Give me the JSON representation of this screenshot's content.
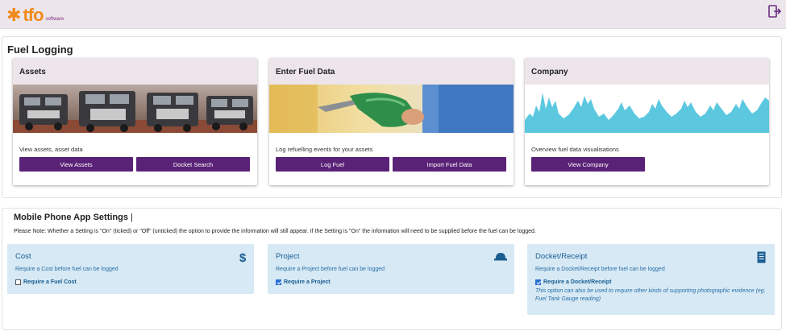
{
  "header": {
    "logo_text": "tfo",
    "logo_sub": "software",
    "logout_icon": "logout-icon"
  },
  "section_title": "Fuel Logging",
  "cards": [
    {
      "title": "Assets",
      "description": "View assets, asset data",
      "buttons": [
        "View Assets",
        "Docket Search"
      ]
    },
    {
      "title": "Enter Fuel Data",
      "description": "Log refuelling events for your assets",
      "buttons": [
        "Log Fuel",
        "Import Fuel Data"
      ]
    },
    {
      "title": "Company",
      "description": "Overview fuel data visualisations",
      "buttons": [
        "View Company"
      ]
    }
  ],
  "settings": {
    "title": "Mobile Phone App Settings",
    "caret": "|",
    "note": "Please Note: Whether a Setting is \"On\" (ticked) or \"Off\" (unticked) the option to provide the information will still appear. If the Setting is \"On\" the information will need to be supplied before the fuel can be logged.",
    "items": [
      {
        "title": "Cost",
        "description": "Require a Cost before fuel can be logged",
        "checkbox_label": "Require a Fuel Cost",
        "checked": false,
        "icon": "dollar-icon"
      },
      {
        "title": "Project",
        "description": "Require a Project before fuel can be logged",
        "checkbox_label": "Require a Project",
        "checked": true,
        "icon": "hard-hat-icon"
      },
      {
        "title": "Docket/Receipt",
        "description": "Require a Docket/Receipt before fuel can be logged",
        "checkbox_label": "Require a Docket/Receipt",
        "checked": true,
        "extra": "This option can also be used to require other kinds of supporting photographic evidence (eg. Fuel Tank Gauge reading)",
        "icon": "receipt-icon"
      }
    ]
  },
  "colors": {
    "brand_orange": "#f08a1c",
    "button_purple": "#5a2277",
    "setting_bg": "#d6e9f5",
    "setting_text": "#1a5d91",
    "chart_fill": "#5bc8e0"
  }
}
